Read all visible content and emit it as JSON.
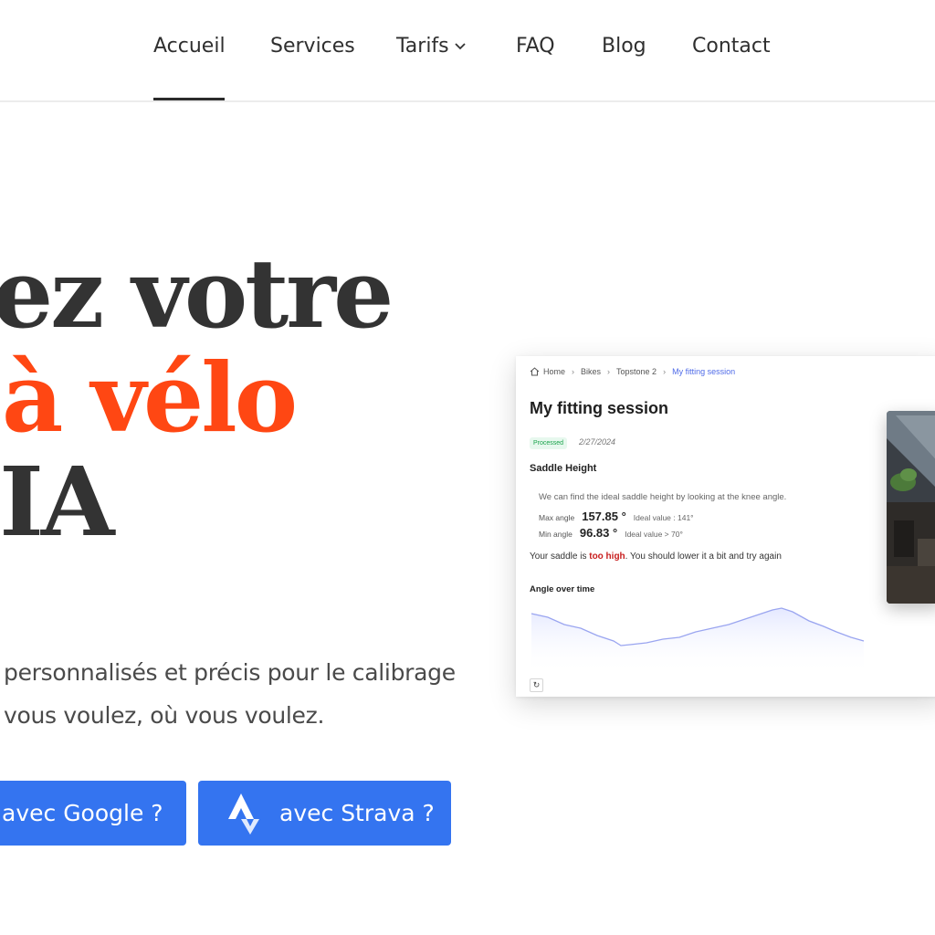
{
  "nav": {
    "items": [
      {
        "label": "Accueil",
        "active": true
      },
      {
        "label": "Services"
      },
      {
        "label": "Tarifs",
        "has_dropdown": true
      },
      {
        "label": "FAQ"
      },
      {
        "label": "Blog"
      },
      {
        "label": "Contact"
      }
    ]
  },
  "hero": {
    "line1": "ez votre",
    "line2": "à vélo",
    "line3": "’IA",
    "subtitle_line1": "personnalisés et précis pour le calibrage",
    "subtitle_line2": "vous voulez, où vous voulez.",
    "accent_color": "#ff4713"
  },
  "buttons": {
    "google_label": "avec Google ?",
    "strava_label": "avec Strava ?",
    "color": "#3474f0"
  },
  "app_card": {
    "breadcrumbs": [
      "Home",
      "Bikes",
      "Topstone 2",
      "My fitting session"
    ],
    "title": "My fitting session",
    "status_badge": "Processed",
    "date": "2/27/2024",
    "section_title": "Saddle Height",
    "description": "We can find the ideal saddle height by looking at the knee angle.",
    "max_label": "Max angle",
    "max_value": "157.85 °",
    "max_ideal": "Ideal value : 141°",
    "min_label": "Min angle",
    "min_value": "96.83 °",
    "min_ideal": "Ideal value > 70°",
    "verdict_prefix": "Your saddle is ",
    "verdict_emphasis": "too high",
    "verdict_suffix": ". You should lower it a bit and try again",
    "chart_title": "Angle over time",
    "line_color": "#9aa5f0"
  },
  "icons": {
    "home": "home-icon",
    "chevron": "chevron-right-icon",
    "dropdown": "chevron-down-icon",
    "strava": "strava-icon",
    "refresh": "refresh-icon"
  }
}
